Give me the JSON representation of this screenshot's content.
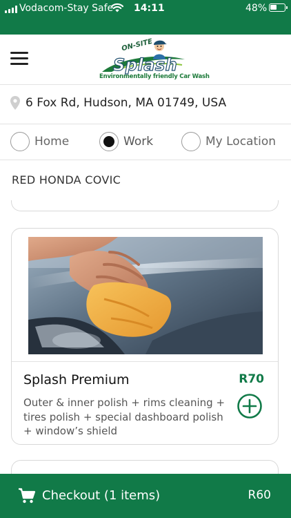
{
  "status_bar": {
    "carrier": "Vodacom-Stay Safe",
    "time": "14:11",
    "battery_percent": "48%",
    "battery_level": 0.48
  },
  "header": {
    "menu_icon": "hamburger-menu-icon",
    "logo": {
      "top_text": "ON-SITE",
      "brand": "Splash",
      "tagline": "Environmentally friendly Car Wash"
    }
  },
  "address": {
    "icon": "location-pin-icon",
    "text": "6 Fox Rd, Hudson, MA 01749, USA"
  },
  "address_types": {
    "selected": "Work",
    "options": [
      {
        "label": "Home",
        "checked": false
      },
      {
        "label": "Work",
        "checked": true
      },
      {
        "label": "My Location",
        "checked": false
      }
    ]
  },
  "vehicle": {
    "name": "RED HONDA COVIC"
  },
  "services": [
    {
      "title": "Splash Premium",
      "price": "R70",
      "description": "Outer & inner polish + rims cleaning + tires polish + special dashboard polish + window’s shield",
      "image": "hand-polishing-car-hood-with-yellow-cloth",
      "add_icon": "add-circle-icon"
    }
  ],
  "checkout": {
    "icon": "shopping-cart-icon",
    "label": "Checkout (1 items)",
    "total": "R60"
  },
  "colors": {
    "brand_green": "#117a48",
    "radio_border": "#9a9a9a",
    "divider": "#e2e2e2"
  }
}
